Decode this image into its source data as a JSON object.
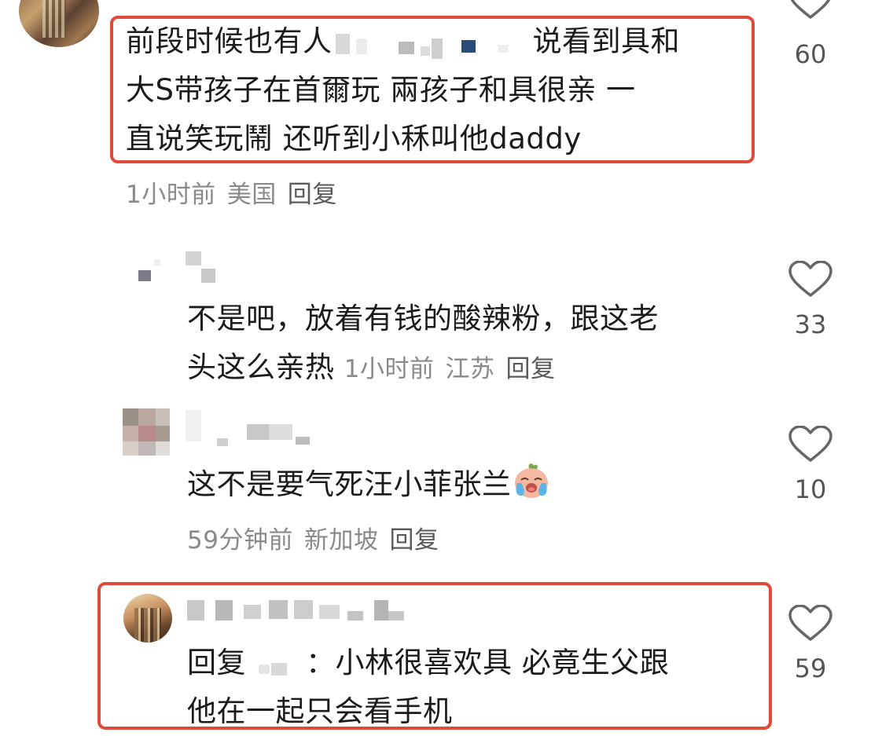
{
  "comments": [
    {
      "text_line1_pre": "前段时候也有人",
      "text_line1_post": "说看到具和",
      "text_line2": "大S带孩子在首爾玩 兩孩子和具很亲 一",
      "text_line3": "直说笑玩鬧 还听到小秝叫他daddy",
      "time": "1小时前",
      "location": "美国",
      "reply_label": "回复",
      "likes": "60",
      "heart_icon": "heart-outline-icon"
    },
    {
      "text_line1": "不是吧，放着有钱的酸辣粉，跟这老",
      "text_line2": "头这么亲热",
      "time": "1小时前",
      "location": "江苏",
      "reply_label": "回复",
      "likes": "33",
      "heart_icon": "heart-outline-icon"
    },
    {
      "text": "这不是要气死汪小菲张兰",
      "emoji": "crying-face-emoji",
      "time": "59分钟前",
      "location": "新加坡",
      "reply_label": "回复",
      "likes": "10",
      "heart_icon": "heart-outline-icon"
    },
    {
      "reply_prefix": "回复",
      "colon": "：",
      "text_line1": "小林很喜欢具 必竟生父跟",
      "text_line2": "他在一起只会看手机",
      "likes": "59",
      "heart_icon": "heart-outline-icon"
    }
  ],
  "colors": {
    "highlight_border": "#e14a38",
    "meta_text": "#8a8a8a",
    "body_text": "#1b1b1b"
  }
}
